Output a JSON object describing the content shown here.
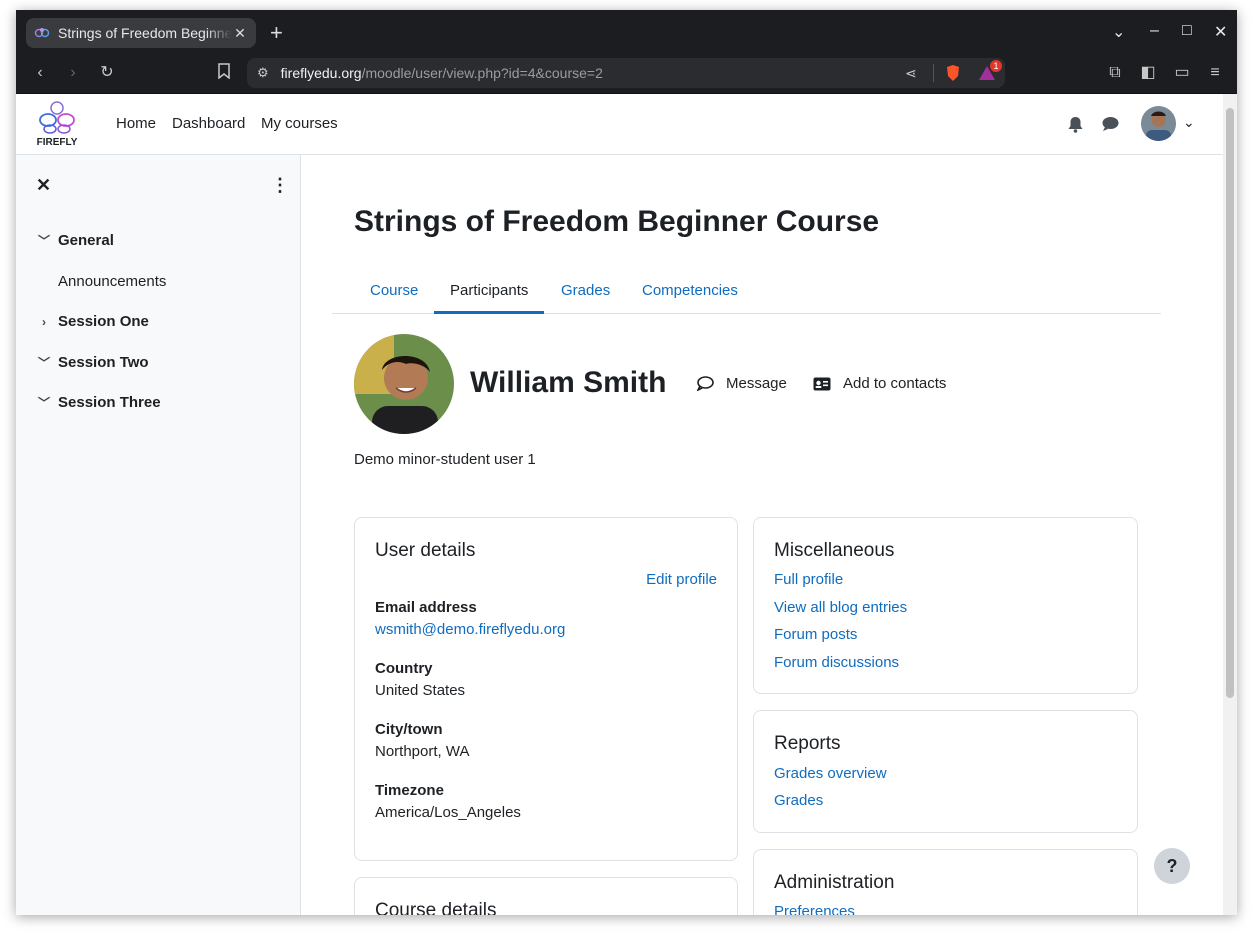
{
  "browser": {
    "tab_title": "Strings of Freedom Beginner Course",
    "url_host": "fireflyedu.org",
    "url_path": "/moodle/user/view.php?id=4&course=2",
    "notification_badge": "1"
  },
  "navbar": {
    "logo_text": "FIREFLY",
    "links": [
      "Home",
      "Dashboard",
      "My courses"
    ]
  },
  "drawer": {
    "sections": [
      {
        "label": "General",
        "expanded": true,
        "items": [
          "Announcements"
        ]
      },
      {
        "label": "Session One",
        "expanded": false
      },
      {
        "label": "Session Two",
        "expanded": true
      },
      {
        "label": "Session Three",
        "expanded": true
      }
    ]
  },
  "course": {
    "title": "Strings of Freedom Beginner Course",
    "tabs": [
      "Course",
      "Participants",
      "Grades",
      "Competencies"
    ],
    "active_tab": "Participants"
  },
  "profile": {
    "name": "William Smith",
    "message_label": "Message",
    "add_contacts_label": "Add to contacts",
    "description": "Demo minor-student user 1"
  },
  "user_details": {
    "heading": "User details",
    "edit_profile": "Edit profile",
    "email_label": "Email address",
    "email": "wsmith@demo.fireflyedu.org",
    "country_label": "Country",
    "country": "United States",
    "city_label": "City/town",
    "city": "Northport, WA",
    "timezone_label": "Timezone",
    "timezone": "America/Los_Angeles"
  },
  "course_details": {
    "heading": "Course details"
  },
  "misc": {
    "heading": "Miscellaneous",
    "links": [
      "Full profile",
      "View all blog entries",
      "Forum posts",
      "Forum discussions"
    ]
  },
  "reports": {
    "heading": "Reports",
    "links": [
      "Grades overview",
      "Grades"
    ]
  },
  "administration": {
    "heading": "Administration",
    "links": [
      "Preferences"
    ]
  },
  "help_label": "?"
}
